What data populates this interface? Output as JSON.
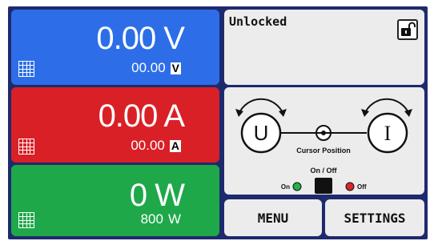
{
  "voltage": {
    "value": "0.00 V",
    "set_value": "00.00",
    "unit": "V"
  },
  "current": {
    "value": "0.00 A",
    "set_value": "00.00",
    "unit": "A"
  },
  "power": {
    "value": "0 W",
    "set_value": "800",
    "unit": "W"
  },
  "status": {
    "text": "Unlocked"
  },
  "control": {
    "knob_left": "U",
    "knob_right": "I",
    "cursor_label": "Cursor Position",
    "onoff_label": "On / Off",
    "on_label": "On",
    "off_label": "Off"
  },
  "buttons": {
    "menu": "MENU",
    "settings": "SETTINGS"
  },
  "colors": {
    "voltage": "#2d6ee8",
    "current": "#d92026",
    "power": "#1fa84a",
    "on_led": "#22b24a",
    "off_led": "#d9262b",
    "frame": "#1e2a6e"
  },
  "icons": {
    "lock": "unlocked-padlock-icon",
    "set": "grid-icon"
  }
}
